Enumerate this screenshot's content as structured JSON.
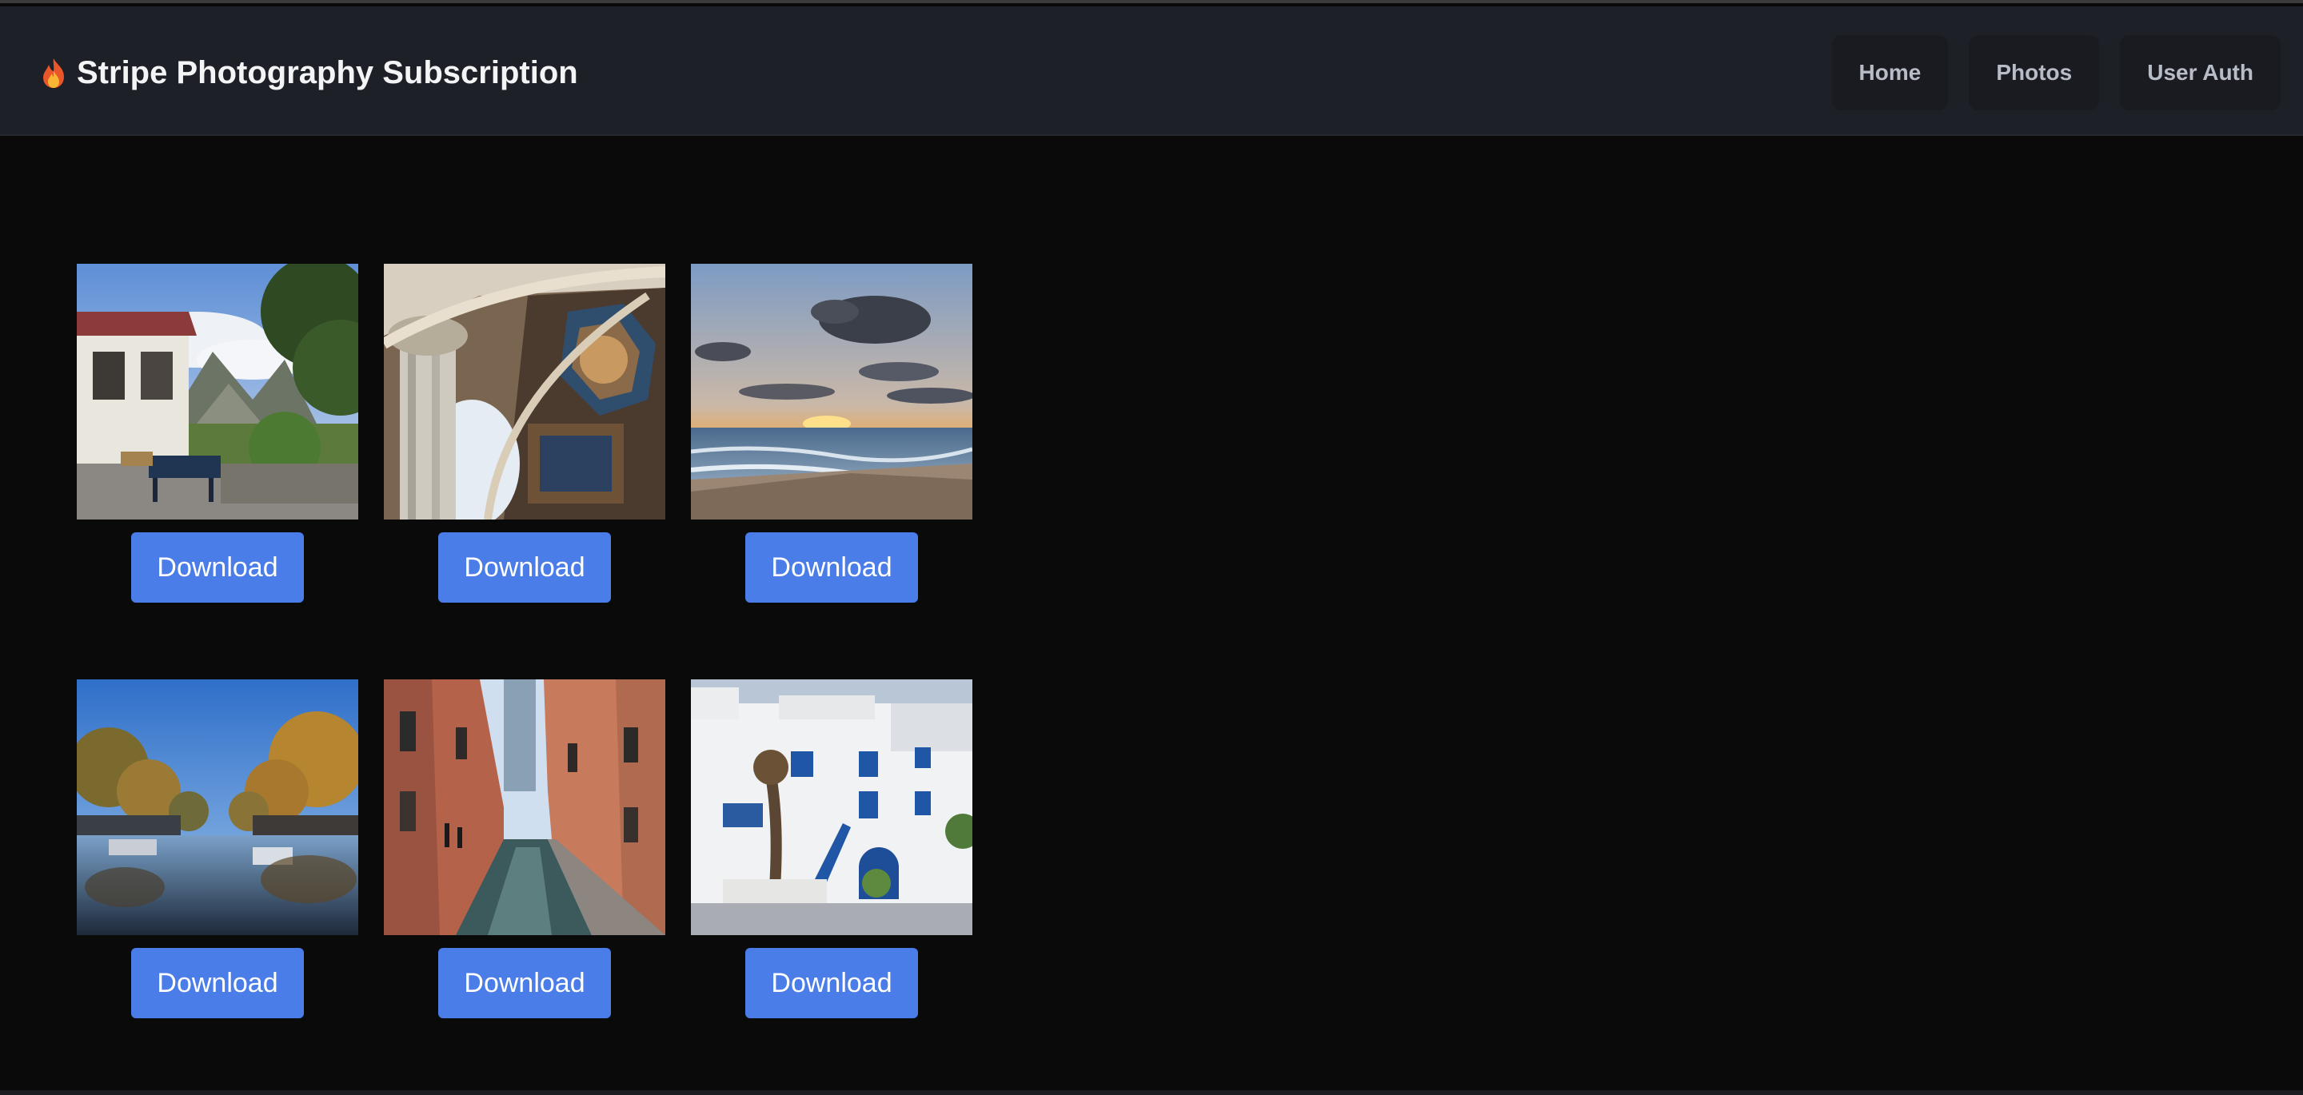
{
  "navbar": {
    "brand_icon": "flame-icon",
    "brand_title": "Stripe Photography Subscription",
    "links": [
      {
        "label": "Home"
      },
      {
        "label": "Photos"
      },
      {
        "label": "User Auth"
      }
    ]
  },
  "gallery": {
    "photos": [
      {
        "scene": "mountain-bench",
        "button_label": "Download"
      },
      {
        "scene": "cathedral-ceiling",
        "button_label": "Download"
      },
      {
        "scene": "beach-sunset",
        "button_label": "Download"
      },
      {
        "scene": "canal-autumn",
        "button_label": "Download"
      },
      {
        "scene": "venice-canal",
        "button_label": "Download"
      },
      {
        "scene": "white-blue-buildings",
        "button_label": "Download"
      }
    ]
  },
  "colors": {
    "navbar_bg": "#1e2027",
    "page_bg": "#0a0a0b",
    "accent_button": "#4a7de8",
    "nav_text": "#b8bcc6"
  }
}
